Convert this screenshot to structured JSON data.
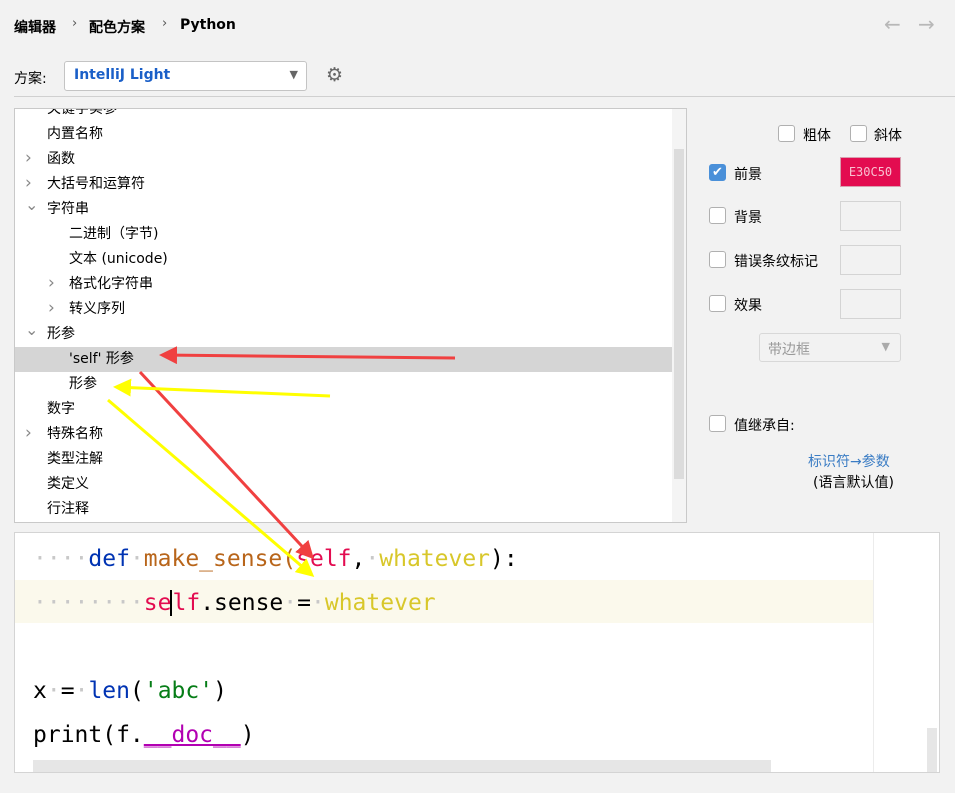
{
  "breadcrumb": [
    "编辑器",
    "配色方案",
    "Python"
  ],
  "scheme": {
    "label": "方案:",
    "value": "IntelliJ Light"
  },
  "tree": [
    {
      "label": "关键字实参",
      "level": 0,
      "chevron": ""
    },
    {
      "label": "内置名称",
      "level": 0,
      "chevron": ""
    },
    {
      "label": "函数",
      "level": 0,
      "chevron": "right"
    },
    {
      "label": "大括号和运算符",
      "level": 0,
      "chevron": "right"
    },
    {
      "label": "字符串",
      "level": 0,
      "chevron": "down"
    },
    {
      "label": "二进制（字节)",
      "level": 1,
      "chevron": ""
    },
    {
      "label": "文本 (unicode)",
      "level": 1,
      "chevron": ""
    },
    {
      "label": "格式化字符串",
      "level": 1,
      "chevron": "right"
    },
    {
      "label": "转义序列",
      "level": 1,
      "chevron": "right"
    },
    {
      "label": "形参",
      "level": 0,
      "chevron": "down"
    },
    {
      "label": "'self' 形参",
      "level": 1,
      "chevron": "",
      "selected": true
    },
    {
      "label": "形参",
      "level": 1,
      "chevron": ""
    },
    {
      "label": "数字",
      "level": 0,
      "chevron": ""
    },
    {
      "label": "特殊名称",
      "level": 0,
      "chevron": "right"
    },
    {
      "label": "类型注解",
      "level": 0,
      "chevron": ""
    },
    {
      "label": "类定义",
      "level": 0,
      "chevron": ""
    },
    {
      "label": "行注释",
      "level": 0,
      "chevron": ""
    }
  ],
  "attrs": {
    "bold": "粗体",
    "italic": "斜体",
    "foreground": "前景",
    "foreground_checked": true,
    "foreground_color": "E30C50",
    "foreground_hex": "#E30C50",
    "background": "背景",
    "error_stripe": "错误条纹标记",
    "effects": "效果",
    "effect_type": "带边框",
    "inherit": "值继承自:",
    "inherit_link": "标识符→参数",
    "inherit_note": "(语言默认值)"
  },
  "code": {
    "line1": {
      "def": "def",
      "fn": "make_sense",
      "open": "(",
      "self": "self",
      "comma": ",",
      "param": "whatever",
      "close": "):"
    },
    "line2": {
      "se": "se",
      "lf": "lf",
      "rest": ".sense",
      "eq": "=",
      "param": "whatever"
    },
    "line3": {
      "x": "x",
      "eq": "=",
      "len": "len",
      "open": "(",
      "str": "'abc'",
      "close": ")"
    },
    "line4": {
      "print": "print(f.",
      "doc": "__doc__",
      "close": ")"
    }
  },
  "colors": {
    "self": "#E30C50",
    "param": "#D8C72A",
    "keyword": "#0033B3",
    "function": "#B8651A",
    "string": "#067D17",
    "special": "#B200B2",
    "annotation_red": "#F04040",
    "annotation_yellow": "#FFFF00"
  }
}
